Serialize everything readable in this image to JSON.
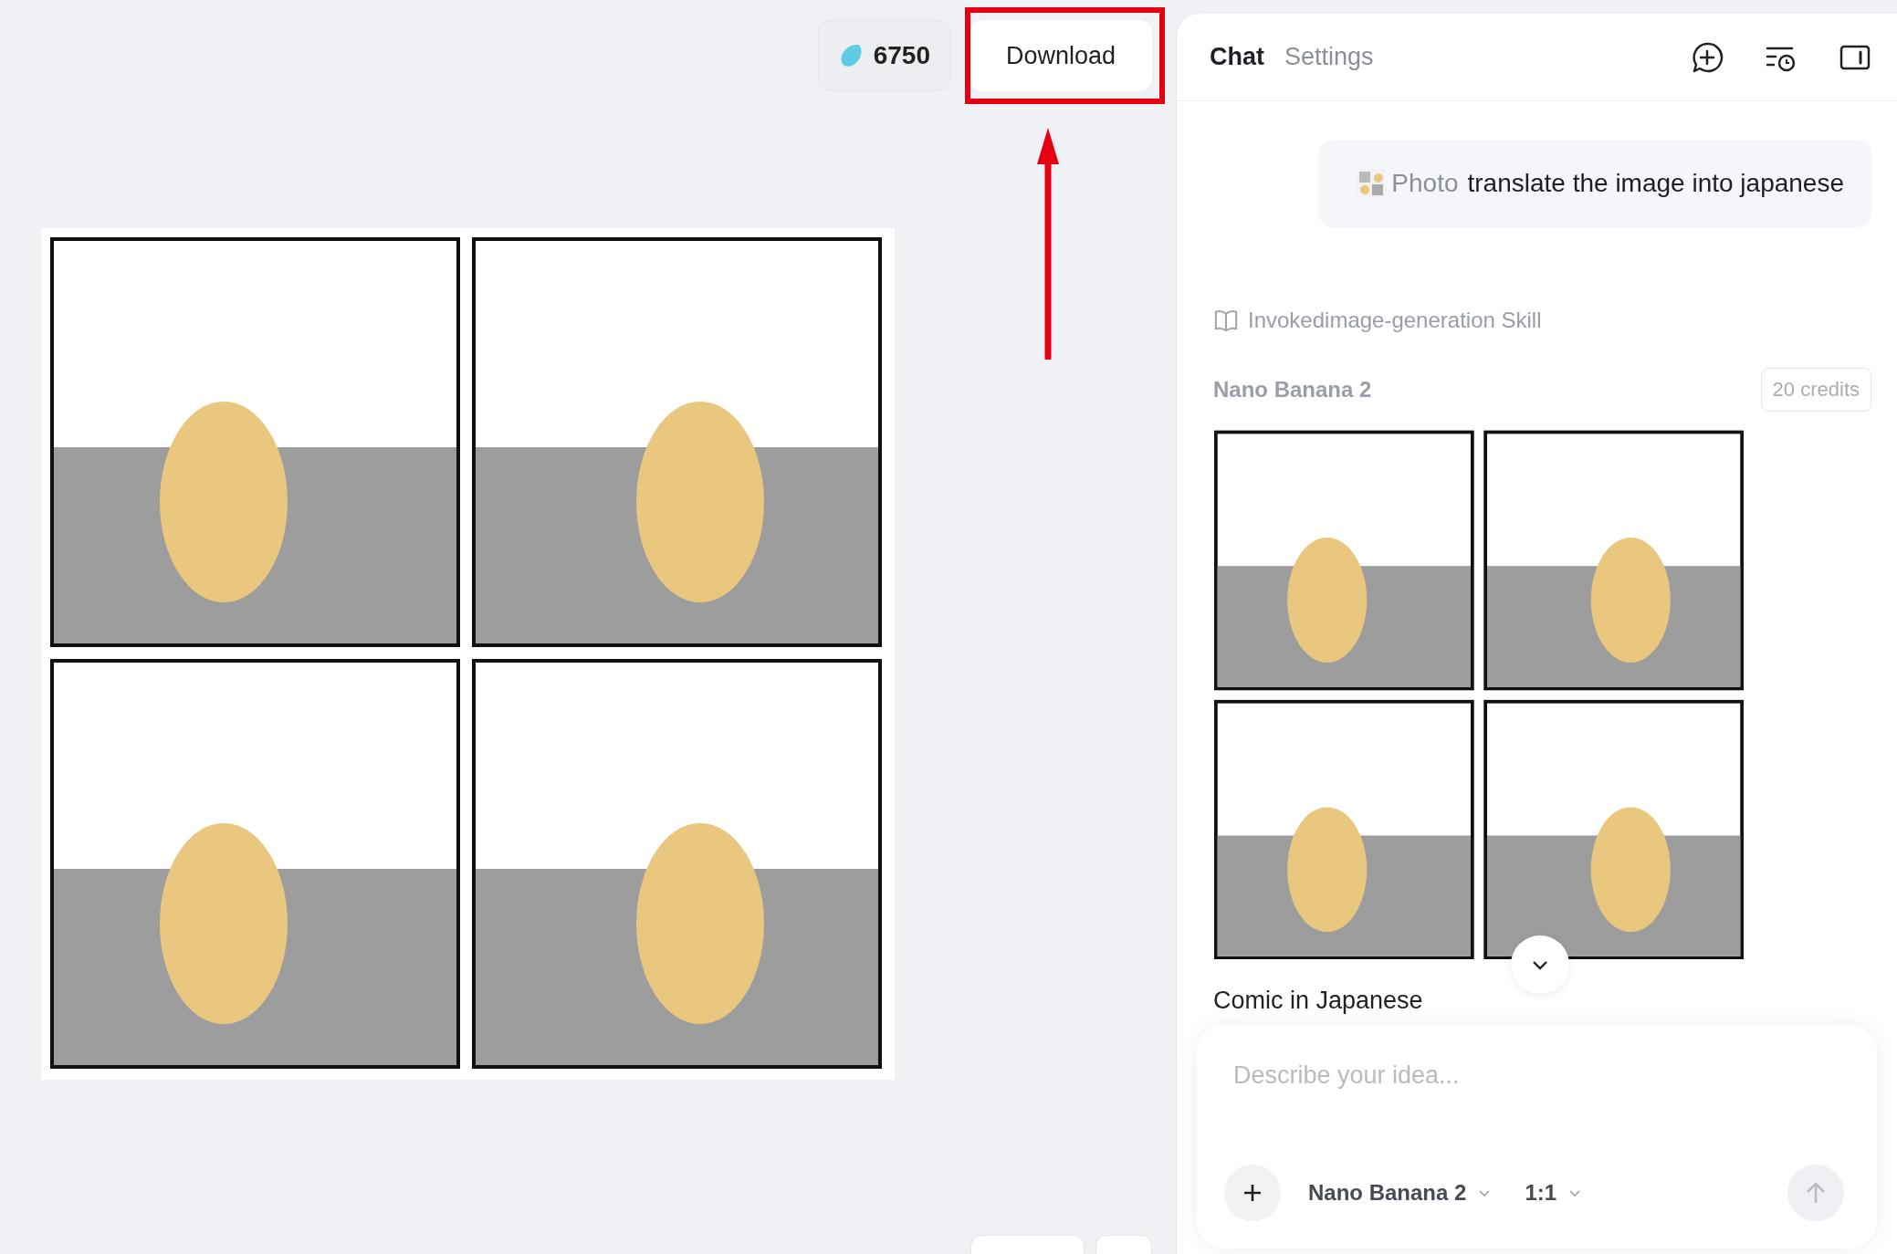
{
  "balance": "6750",
  "download_button": "Download",
  "tabs": [
    {
      "label": "Chat",
      "selected": true
    },
    {
      "label": "Settings",
      "selected": false
    }
  ],
  "user_message": {
    "attachment": "Photo",
    "text": "translate the image into japanese"
  },
  "skill_note": "Invokedimage-generation Skill",
  "result": {
    "model": "Nano Banana 2",
    "credits": "20 credits",
    "caption": "Comic in Japanese"
  },
  "composer": {
    "placeholder": "Describe your idea...",
    "model": "Nano Banana 2",
    "ratio": "1:1"
  }
}
